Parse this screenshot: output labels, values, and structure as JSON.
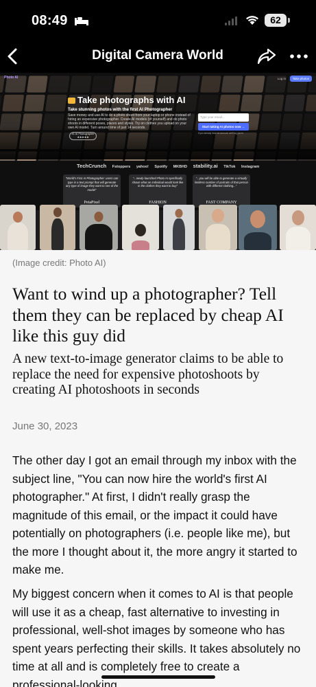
{
  "status_bar": {
    "time": "08:49",
    "battery": "62",
    "icons": [
      "sleep-mode-icon",
      "cellular-signal-icon",
      "wifi-icon",
      "battery-icon"
    ]
  },
  "nav": {
    "title": "Digital Camera World",
    "icons": [
      "back-chevron-icon",
      "share-icon",
      "more-icon"
    ]
  },
  "hero": {
    "headline": "Take photographs with AI",
    "subheadline": "Take stunning photos with the first AI Photographer",
    "body": "Save money and use AI to do a photo shoot from your laptop or phone instead of hiring an expensive photographer. Create AI models (of yourself) and do photo shoots in different poses, places and styles. Try on clothes you upload on your own AI model. Turn around time of just 14 seconds.",
    "badge": "#1 AI Photographer ★★★★★",
    "email_placeholder": "Type your email...",
    "cta": "Start taking AI photos now →",
    "fine_print": "If you already have an account, we'll log you in",
    "top_logo": "Photo AI",
    "top_link": "Log in",
    "top_button": "Take photos",
    "press": [
      "TechCrunch",
      "Fstoppers",
      "yahoo!",
      "Spotify",
      "MKBHD",
      "stability.ai",
      "TikTok",
      "Instagram"
    ],
    "quotes": [
      {
        "text": "\"World's First AI Photographer: users can type in a text prompt that will generate any type of image they want to see of the model\"",
        "source": "PetaPixel"
      },
      {
        "text": "\"...newly-launched Photo AI specifically shows what an individual would look like in the clothes they want to buy\"",
        "source": "FASHION"
      },
      {
        "text": "\"...you will be able to generate a virtually limitless number of portraits of that person with different clothing...\"",
        "source": "FAST COMPANY"
      }
    ]
  },
  "article": {
    "image_credit": "(Image credit: Photo AI)",
    "headline": "Want to wind up a photographer? Tell them they can be replaced by cheap AI like this guy did",
    "subheadline": "A new text-to-image generator claims to be able to replace the need for expensive photoshoots by creating AI photoshoots in seconds",
    "date": "June 30, 2023",
    "paragraphs": [
      "The other day I got an email through my inbox with the subject line, \"You can now hire the world's first AI photographer.\" At first, I didn't really grasp the magnitude of this email, or the impact it could have potentially on photographers (i.e. people like me), but the more I thought about it, the more angry it started to make me.",
      "My biggest concern when it comes to AI is that people will use it as a cheap, fast alternative to investing in professional, well-shot images by someone who has spent years perfecting their skills. It takes absolutely no time at all and is completely free to create a professional-looking"
    ]
  },
  "colors": {
    "chrome": "#000000",
    "page_bg": "#f6f6f6",
    "text": "#111111",
    "muted": "#777777",
    "accent_blue": "#4d6dff"
  }
}
